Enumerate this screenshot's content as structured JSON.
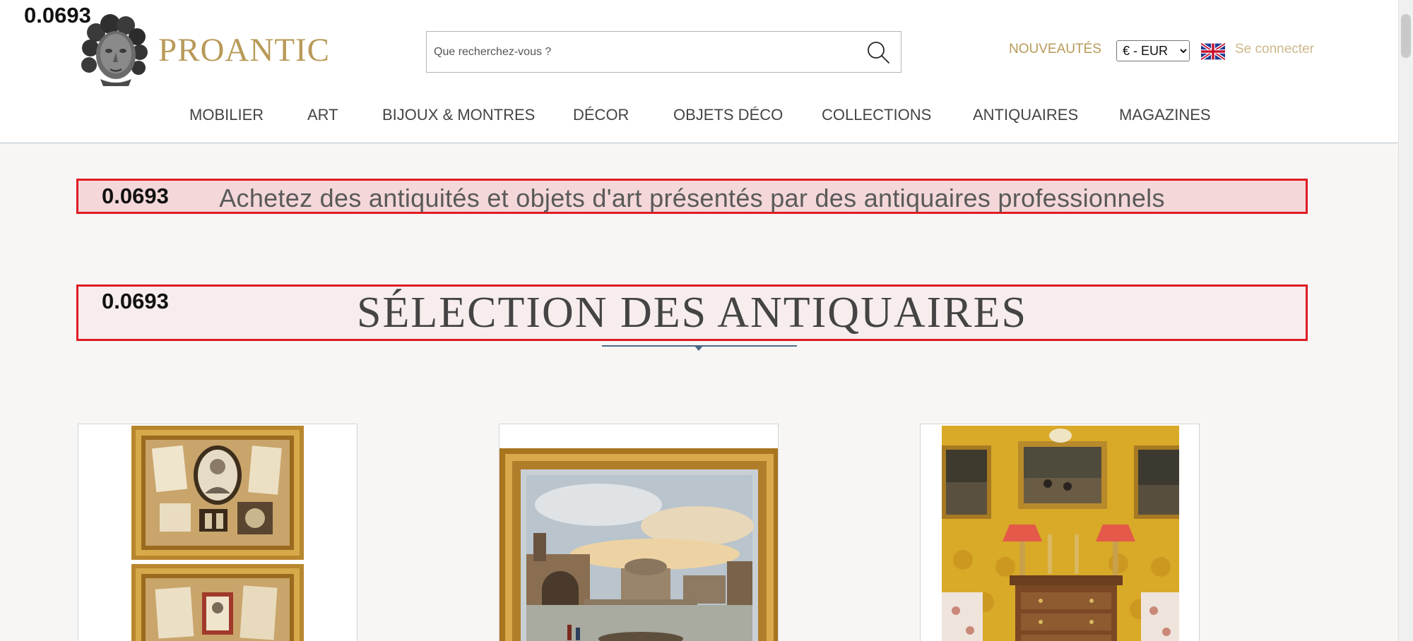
{
  "score_label": "0.0693",
  "header": {
    "logo_text": "PROANTIC",
    "search": {
      "placeholder": "Que recherchez-vous ?",
      "value": ""
    },
    "nouveautes_label": "NOUVEAUTÉS",
    "currency": {
      "selected": "€ - EUR"
    },
    "flag_icon": "uk-flag-icon",
    "login_label": "Se connecter"
  },
  "nav": {
    "items": [
      {
        "label": "MOBILIER"
      },
      {
        "label": "ART"
      },
      {
        "label": "BIJOUX & MONTRES"
      },
      {
        "label": "DÉCOR"
      },
      {
        "label": "OBJETS DÉCO"
      },
      {
        "label": "COLLECTIONS"
      },
      {
        "label": "ANTIQUAIRES"
      },
      {
        "label": "MAGAZINES"
      }
    ]
  },
  "main": {
    "tagline_score": "0.0693",
    "tagline": "Achetez des antiquités et objets d'art présentés par des antiquaires professionnels",
    "section_score": "0.0693",
    "section_title": "SÉLECTION DES ANTIQUAIRES"
  },
  "colors": {
    "brand_gold": "#b89a58",
    "login_gold": "#cdb88a",
    "highlight_border": "#e01b24",
    "underline_blue": "#4a6a86"
  }
}
